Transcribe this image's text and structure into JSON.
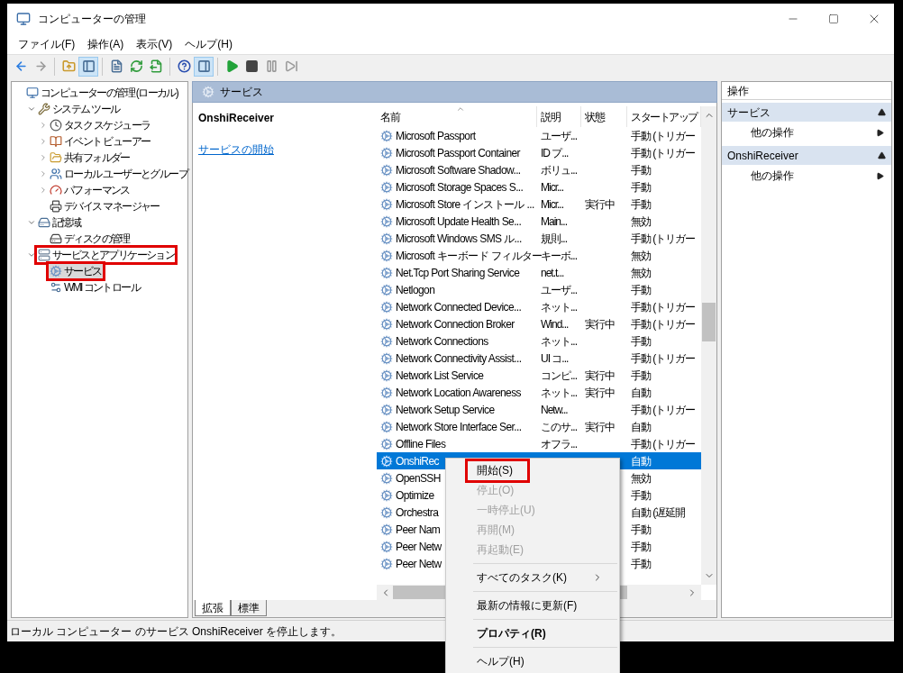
{
  "window": {
    "title": "コンピューターの管理"
  },
  "menu_bar": [
    "ファイル(F)",
    "操作(A)",
    "表示(V)",
    "ヘルプ(H)"
  ],
  "toolbar": [
    {
      "kind": "back",
      "pressed": false,
      "disabled": false
    },
    {
      "kind": "forward",
      "pressed": false,
      "disabled": true
    },
    {
      "kind": "separator"
    },
    {
      "kind": "up",
      "pressed": false,
      "disabled": false
    },
    {
      "kind": "tree-toggle",
      "pressed": true,
      "disabled": false
    },
    {
      "kind": "separator"
    },
    {
      "kind": "properties",
      "pressed": false,
      "disabled": false
    },
    {
      "kind": "refresh",
      "pressed": false,
      "disabled": false
    },
    {
      "kind": "export",
      "pressed": false,
      "disabled": false
    },
    {
      "kind": "separator"
    },
    {
      "kind": "help",
      "pressed": false,
      "disabled": false
    },
    {
      "kind": "action-toggle",
      "pressed": true,
      "disabled": false
    },
    {
      "kind": "separator"
    },
    {
      "kind": "start",
      "pressed": false,
      "disabled": false
    },
    {
      "kind": "stop",
      "pressed": false,
      "disabled": false
    },
    {
      "kind": "pause",
      "pressed": false,
      "disabled": true
    },
    {
      "kind": "resume",
      "pressed": false,
      "disabled": true
    }
  ],
  "tree": [
    {
      "label": "コンピューターの管理 (ローカル)",
      "kind": "computer",
      "selected": false,
      "highlighted": false,
      "children": [
        {
          "label": "システム ツール",
          "kind": "tools",
          "expandable": true,
          "expanded": true,
          "selected": false,
          "highlighted": false,
          "children": [
            {
              "label": "タスク スケジューラ",
              "kind": "clock",
              "expandable": true,
              "expanded": false,
              "selected": false,
              "highlighted": false
            },
            {
              "label": "イベント ビューアー",
              "kind": "event",
              "expandable": true,
              "expanded": false,
              "selected": false,
              "highlighted": false
            },
            {
              "label": "共有フォルダー",
              "kind": "share",
              "expandable": true,
              "expanded": false,
              "selected": false,
              "highlighted": false
            },
            {
              "label": "ローカル ユーザーとグループ",
              "kind": "users",
              "expandable": true,
              "expanded": false,
              "selected": false,
              "highlighted": false
            },
            {
              "label": "パフォーマンス",
              "kind": "performance",
              "expandable": true,
              "expanded": false,
              "selected": false,
              "highlighted": false
            },
            {
              "label": "デバイス マネージャー",
              "kind": "device",
              "expandable": false,
              "expanded": false,
              "selected": false,
              "highlighted": false
            }
          ]
        },
        {
          "label": "記憶域",
          "kind": "storage",
          "expandable": true,
          "expanded": true,
          "selected": false,
          "highlighted": false,
          "children": [
            {
              "label": "ディスクの管理",
              "kind": "disk",
              "expandable": false,
              "expanded": false,
              "selected": false,
              "highlighted": false
            }
          ]
        },
        {
          "label": "サービスとアプリケーション",
          "kind": "server",
          "expandable": true,
          "expanded": true,
          "selected": false,
          "highlighted": true,
          "children": [
            {
              "label": "サービス",
              "kind": "gear",
              "expandable": false,
              "expanded": false,
              "selected": true,
              "highlighted": true
            },
            {
              "label": "WMI コントロール",
              "kind": "wmi",
              "expandable": false,
              "expanded": false,
              "selected": false,
              "highlighted": false
            }
          ]
        }
      ]
    }
  ],
  "center": {
    "title": "サービス",
    "detail_title": "OnshiReceiver",
    "detail_link": "サービスの開始",
    "columns": [
      "名前",
      "説明",
      "状態",
      "スタートアップ"
    ],
    "rows": [
      {
        "name": "Microsoft Passport",
        "description": "ユーザ...",
        "startup": "手動 (トリガー",
        "selected": false
      },
      {
        "name": "Microsoft Passport Container",
        "description": "ID プ...",
        "startup": "手動 (トリガー",
        "selected": false
      },
      {
        "name": "Microsoft Software Shadow...",
        "description": "ボリュ...",
        "startup": "手動",
        "selected": false
      },
      {
        "name": "Microsoft Storage Spaces S...",
        "description": "Micr...",
        "startup": "手動",
        "selected": false
      },
      {
        "name": "Microsoft Store インストール ...",
        "description": "Micr...",
        "status": "実行中",
        "startup": "手動",
        "selected": false
      },
      {
        "name": "Microsoft Update Health Se...",
        "description": "Main...",
        "startup": "無効",
        "selected": false
      },
      {
        "name": "Microsoft Windows SMS ル...",
        "description": "規則...",
        "startup": "手動 (トリガー",
        "selected": false
      },
      {
        "name": "Microsoft キーボード フィルター",
        "description": "キーボ...",
        "startup": "無効",
        "selected": false
      },
      {
        "name": "Net.Tcp Port Sharing Service",
        "description": "net.t...",
        "startup": "無効",
        "selected": false
      },
      {
        "name": "Netlogon",
        "description": "ユーザ...",
        "startup": "手動",
        "selected": false
      },
      {
        "name": "Network Connected Device...",
        "description": "ネット...",
        "startup": "手動 (トリガー",
        "selected": false
      },
      {
        "name": "Network Connection Broker",
        "description": "Wind...",
        "status": "実行中",
        "startup": "手動 (トリガー",
        "selected": false
      },
      {
        "name": "Network Connections",
        "description": "ネット...",
        "startup": "手動",
        "selected": false
      },
      {
        "name": "Network Connectivity Assist...",
        "description": "UI コ...",
        "startup": "手動 (トリガー",
        "selected": false
      },
      {
        "name": "Network List Service",
        "description": "コンピ...",
        "status": "実行中",
        "startup": "手動",
        "selected": false
      },
      {
        "name": "Network Location Awareness",
        "description": "ネット...",
        "status": "実行中",
        "startup": "自動",
        "selected": false
      },
      {
        "name": "Network Setup Service",
        "description": "Netw...",
        "startup": "手動 (トリガー",
        "selected": false
      },
      {
        "name": "Network Store Interface Ser...",
        "description": "このサ...",
        "status": "実行中",
        "startup": "自動",
        "selected": false
      },
      {
        "name": "Offline Files",
        "description": "オフラ...",
        "startup": "手動 (トリガー",
        "selected": false
      },
      {
        "name": "OnshiRec",
        "startup": "自動",
        "selected": true
      },
      {
        "name": "OpenSSH",
        "startup": "無効",
        "selected": false
      },
      {
        "name": "Optimize",
        "startup": "手動",
        "selected": false
      },
      {
        "name": "Orchestra",
        "startup": "自動 (遅延開",
        "selected": false
      },
      {
        "name": "Peer Nam",
        "startup": "手動",
        "selected": false
      },
      {
        "name": "Peer Netw",
        "startup": "手動",
        "selected": false
      },
      {
        "name": "Peer Netw",
        "startup": "手動",
        "selected": false
      }
    ],
    "tabs": [
      {
        "label": "拡張",
        "selected": true
      },
      {
        "label": "標準",
        "selected": false
      }
    ]
  },
  "actions": {
    "title": "操作",
    "sections": [
      {
        "title": "サービス",
        "items": [
          "他の操作"
        ]
      },
      {
        "title": "OnshiReceiver",
        "items": [
          "他の操作"
        ]
      }
    ]
  },
  "status_bar": "ローカル コンピューター のサービス OnshiReceiver を停止します。",
  "context_menu": [
    {
      "kind": "item",
      "label": "開始(S)",
      "disabled": false,
      "highlighted": true,
      "submenu": false,
      "default": false
    },
    {
      "kind": "item",
      "label": "停止(O)",
      "disabled": true,
      "highlighted": false,
      "submenu": false,
      "default": false
    },
    {
      "kind": "item",
      "label": "一時停止(U)",
      "disabled": true,
      "highlighted": false,
      "submenu": false,
      "default": false
    },
    {
      "kind": "item",
      "label": "再開(M)",
      "disabled": true,
      "highlighted": false,
      "submenu": false,
      "default": false
    },
    {
      "kind": "item",
      "label": "再起動(E)",
      "disabled": true,
      "highlighted": false,
      "submenu": false,
      "default": false
    },
    {
      "kind": "separator"
    },
    {
      "kind": "item",
      "label": "すべてのタスク(K)",
      "disabled": false,
      "highlighted": false,
      "submenu": true,
      "default": false
    },
    {
      "kind": "separator"
    },
    {
      "kind": "item",
      "label": "最新の情報に更新(F)",
      "disabled": false,
      "highlighted": false,
      "submenu": false,
      "default": false
    },
    {
      "kind": "separator"
    },
    {
      "kind": "item",
      "label": "プロパティ(R)",
      "disabled": false,
      "highlighted": false,
      "submenu": false,
      "default": true
    },
    {
      "kind": "separator"
    },
    {
      "kind": "item",
      "label": "ヘルプ(H)",
      "disabled": false,
      "highlighted": false,
      "submenu": false,
      "default": false
    }
  ]
}
